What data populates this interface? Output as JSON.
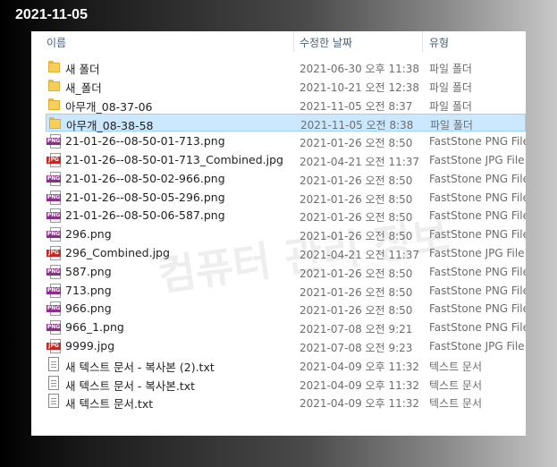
{
  "date_label": "2021-11-05",
  "columns": {
    "name": "이름",
    "date": "수정한 날짜",
    "type": "유형"
  },
  "watermark": "컴퓨터 관리 정보",
  "files": [
    {
      "name": "새 폴더",
      "date": "2021-06-30 오후 11:38",
      "type": "파일 폴더",
      "icon": "folder-icon"
    },
    {
      "name": "새_폴더",
      "date": "2021-10-21 오전 12:38",
      "type": "파일 폴더",
      "icon": "folder-icon"
    },
    {
      "name": "아무개_08-37-06",
      "date": "2021-11-05 오전 8:37",
      "type": "파일 폴더",
      "icon": "folder-icon"
    },
    {
      "name": "아무개_08-38-58",
      "date": "2021-11-05 오전 8:38",
      "type": "파일 폴더",
      "icon": "folder-icon",
      "selected": true
    },
    {
      "name": "21-01-26--08-50-01-713.png",
      "date": "2021-01-26 오전 8:50",
      "type": "FastStone PNG File",
      "icon": "png-file-icon"
    },
    {
      "name": "21-01-26--08-50-01-713_Combined.jpg",
      "date": "2021-04-21 오전 11:37",
      "type": "FastStone JPG File",
      "icon": "jpg-file-icon"
    },
    {
      "name": "21-01-26--08-50-02-966.png",
      "date": "2021-01-26 오전 8:50",
      "type": "FastStone PNG File",
      "icon": "png-file-icon"
    },
    {
      "name": "21-01-26--08-50-05-296.png",
      "date": "2021-01-26 오전 8:50",
      "type": "FastStone PNG File",
      "icon": "png-file-icon"
    },
    {
      "name": "21-01-26--08-50-06-587.png",
      "date": "2021-01-26 오전 8:50",
      "type": "FastStone PNG File",
      "icon": "png-file-icon"
    },
    {
      "name": "296.png",
      "date": "2021-01-26 오전 8:50",
      "type": "FastStone PNG File",
      "icon": "png-file-icon"
    },
    {
      "name": "296_Combined.jpg",
      "date": "2021-04-21 오전 11:37",
      "type": "FastStone JPG File",
      "icon": "jpg-file-icon"
    },
    {
      "name": "587.png",
      "date": "2021-01-26 오전 8:50",
      "type": "FastStone PNG File",
      "icon": "png-file-icon"
    },
    {
      "name": "713.png",
      "date": "2021-01-26 오전 8:50",
      "type": "FastStone PNG File",
      "icon": "png-file-icon"
    },
    {
      "name": "966.png",
      "date": "2021-01-26 오전 8:50",
      "type": "FastStone PNG File",
      "icon": "png-file-icon"
    },
    {
      "name": "966_1.png",
      "date": "2021-07-08 오전 9:21",
      "type": "FastStone PNG File",
      "icon": "png-file-icon"
    },
    {
      "name": "9999.jpg",
      "date": "2021-07-08 오전 9:23",
      "type": "FastStone JPG File",
      "icon": "jpg-file-icon"
    },
    {
      "name": "새 텍스트 문서 - 복사본 (2).txt",
      "date": "2021-04-09 오후 11:32",
      "type": "텍스트 문서",
      "icon": "text-file-icon"
    },
    {
      "name": "새 텍스트 문서 - 복사본.txt",
      "date": "2021-04-09 오후 11:32",
      "type": "텍스트 문서",
      "icon": "text-file-icon"
    },
    {
      "name": "새 텍스트 문서.txt",
      "date": "2021-04-09 오후 11:32",
      "type": "텍스트 문서",
      "icon": "text-file-icon"
    }
  ],
  "icon_tags": {
    "png": "PNG",
    "jpg": "JPG"
  },
  "colors": {
    "selection": "#cce8ff",
    "folder": "#f6cf5a",
    "png_badge": "#8b2d8b",
    "jpg_badge": "#c62828"
  }
}
